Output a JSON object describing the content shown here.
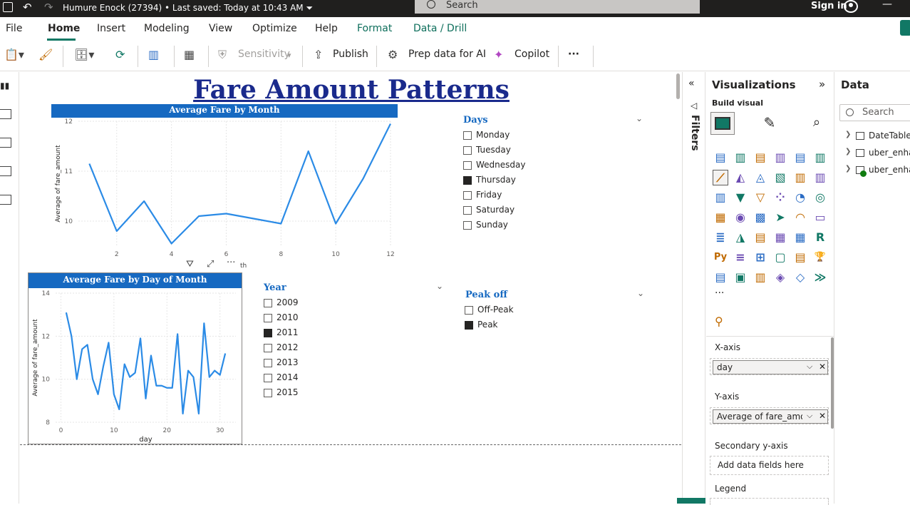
{
  "titlebar": {
    "doc_title": "Humure Enock (27394) • Last saved: Today at 10:43 AM ⏷",
    "search_placeholder": "Search",
    "signin": "Sign in"
  },
  "menu": {
    "items": [
      "File",
      "Home",
      "Insert",
      "Modeling",
      "View",
      "Optimize",
      "Help",
      "Format",
      "Data / Drill"
    ],
    "active": "Home"
  },
  "ribbon": {
    "sensitivity": "Sensitivity",
    "publish": "Publish",
    "prep_data": "Prep data for AI",
    "copilot": "Copilot",
    "more": "···"
  },
  "canvas": {
    "report_title": "Fare Amount Patterns",
    "visual_toolbar_caption": "th"
  },
  "chart_data": [
    {
      "type": "line",
      "title": "Average Fare by Month",
      "ylabel": "Average of fare_amount",
      "xlabel": "",
      "x": [
        1,
        2,
        3,
        4,
        5,
        6,
        7,
        8,
        9,
        10,
        11,
        12
      ],
      "series": [
        {
          "values": [
            11.15,
            9.8,
            10.4,
            9.55,
            10.1,
            10.15,
            10.05,
            9.95,
            11.4,
            9.95,
            10.85,
            11.95
          ]
        }
      ],
      "xticks": [
        "2",
        "4",
        "6",
        "8",
        "10",
        "12"
      ],
      "yticks": [
        "10",
        "11",
        "12"
      ],
      "xlim": [
        0.6,
        12
      ],
      "ylim": [
        9.5,
        12
      ],
      "color": "#2b8be6",
      "grid": true
    },
    {
      "type": "line",
      "title": "Average Fare by Day of Month",
      "ylabel": "Average of fare_amount",
      "xlabel": "day",
      "x": [
        1,
        2,
        3,
        4,
        5,
        6,
        7,
        8,
        9,
        10,
        11,
        12,
        13,
        14,
        15,
        16,
        17,
        18,
        19,
        20,
        21,
        22,
        23,
        24,
        25,
        26,
        27,
        28,
        29,
        30,
        31
      ],
      "series": [
        {
          "values": [
            13.1,
            12.0,
            10.0,
            11.4,
            11.6,
            10.0,
            9.3,
            10.6,
            11.7,
            9.3,
            8.6,
            10.7,
            10.1,
            10.3,
            11.9,
            9.1,
            11.1,
            9.7,
            9.7,
            9.6,
            9.6,
            12.1,
            8.4,
            10.4,
            10.1,
            8.4,
            12.6,
            10.1,
            10.4,
            10.2,
            11.2
          ]
        }
      ],
      "xticks": [
        "0",
        "10",
        "20",
        "30"
      ],
      "yticks": [
        "8",
        "10",
        "12",
        "14"
      ],
      "xlim": [
        -1,
        33
      ],
      "ylim": [
        8,
        14
      ],
      "color": "#2b8be6",
      "grid": true
    }
  ],
  "slicers": {
    "days": {
      "title": "Days",
      "options": [
        {
          "label": "Monday",
          "checked": false
        },
        {
          "label": "Tuesday",
          "checked": false
        },
        {
          "label": "Wednesday",
          "checked": false
        },
        {
          "label": "Thursday",
          "checked": true
        },
        {
          "label": "Friday",
          "checked": false
        },
        {
          "label": "Saturday",
          "checked": false
        },
        {
          "label": "Sunday",
          "checked": false
        }
      ]
    },
    "year": {
      "title": "Year",
      "options": [
        {
          "label": "2009",
          "checked": false
        },
        {
          "label": "2010",
          "checked": false
        },
        {
          "label": "2011",
          "checked": true
        },
        {
          "label": "2012",
          "checked": false
        },
        {
          "label": "2013",
          "checked": false
        },
        {
          "label": "2014",
          "checked": false
        },
        {
          "label": "2015",
          "checked": false
        }
      ]
    },
    "peak": {
      "title": "Peak off",
      "options": [
        {
          "label": "Off-Peak",
          "checked": false
        },
        {
          "label": "Peak",
          "checked": true
        }
      ]
    }
  },
  "filters": {
    "label": "Filters"
  },
  "visualizations": {
    "title": "Visualizations",
    "build_visual": "Build visual",
    "more": "···",
    "wells": [
      {
        "label": "X-axis",
        "field": "day"
      },
      {
        "label": "Y-axis",
        "field": "Average of fare_amou..."
      },
      {
        "label": "Secondary y-axis",
        "placeholder": "Add data fields here"
      },
      {
        "label": "Legend"
      }
    ]
  },
  "data_pane": {
    "title": "Data",
    "search_placeholder": "Search",
    "tables": [
      "DateTable",
      "uber_enhar",
      "uber_enhar"
    ]
  },
  "colors": {
    "accent": "#117865",
    "title_blue": "#1a2a8c",
    "header_blue": "#1669c1",
    "line": "#2b8be6"
  }
}
